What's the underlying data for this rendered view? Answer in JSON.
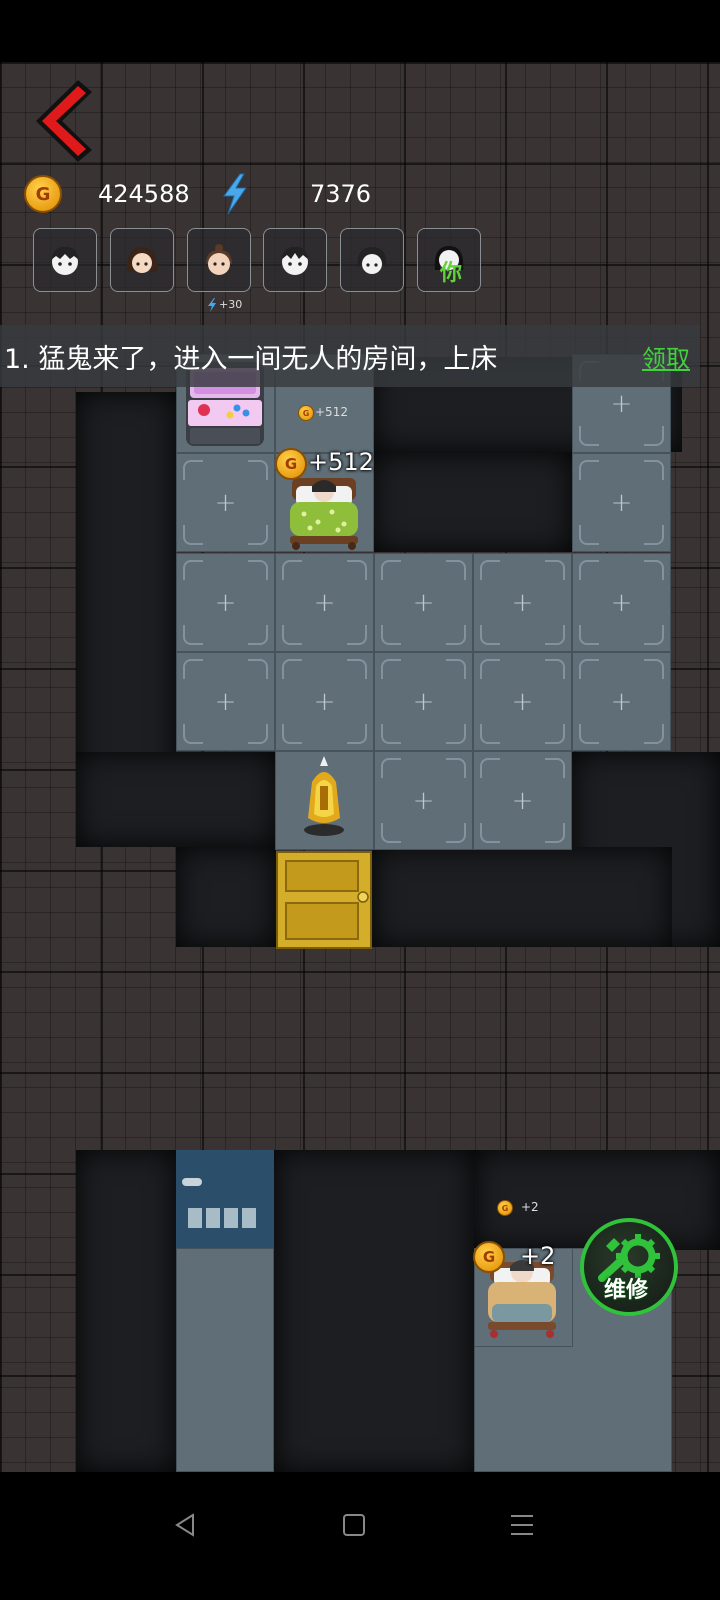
{
  "hud": {
    "gold_amount": "424588",
    "energy_amount": "7376",
    "energy_bonus": "+30"
  },
  "players": [
    {
      "name": "player-1"
    },
    {
      "name": "player-2"
    },
    {
      "name": "player-3"
    },
    {
      "name": "player-4"
    },
    {
      "name": "player-5"
    },
    {
      "name": "player-you",
      "label": "你"
    }
  ],
  "quest": {
    "text": "1. 猛鬼来了，进入一间无人的房间，上床",
    "claim_label": "领取"
  },
  "room": {
    "coin_gain_small": "+512",
    "coin_gain": "+512",
    "empty_slot": "+"
  },
  "lower_room": {
    "coin_gain_small": "+2",
    "coin_gain": "+2"
  },
  "repair_button": {
    "label": "维修"
  },
  "colors": {
    "accent_red": "#e01a1a",
    "claim_green": "#3fd23a",
    "repair_green": "#2fc23a",
    "gold": "#f2b21b",
    "door_gold": "#d4ad2a"
  }
}
